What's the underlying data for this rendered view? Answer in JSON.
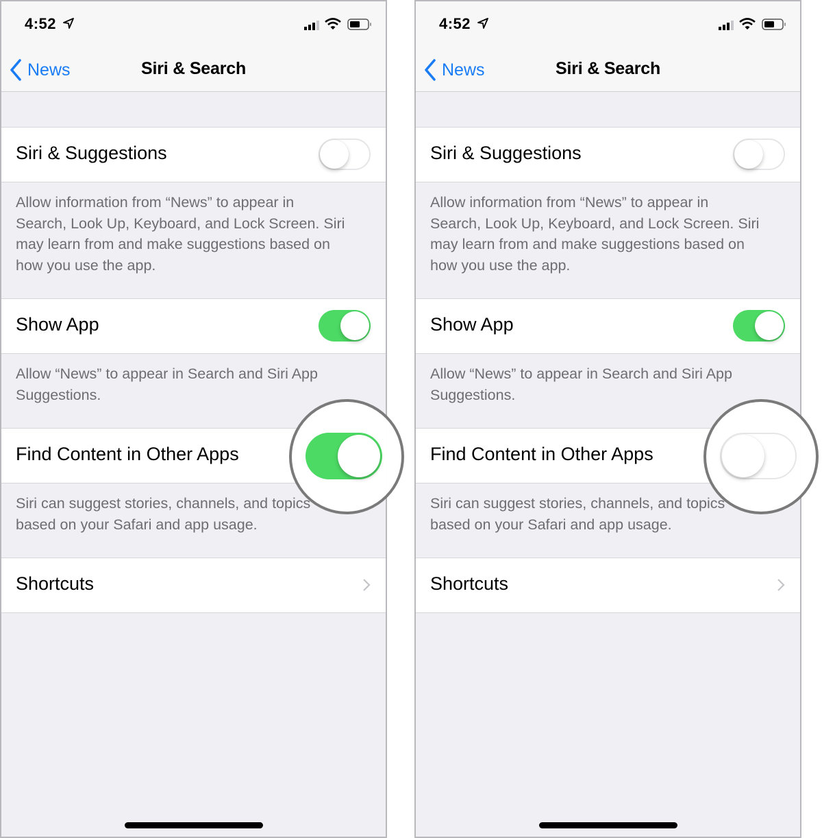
{
  "screens": [
    {
      "status": {
        "time": "4:52"
      },
      "nav": {
        "back_label": "News",
        "title": "Siri & Search"
      },
      "rows": {
        "siri_suggestions": {
          "label": "Siri & Suggestions",
          "on": false,
          "footer": [
            "Allow information from “News” to appear in",
            "Search, Look Up, Keyboard, and Lock Screen. Siri",
            "may learn from and make suggestions based on",
            "how you use the app."
          ]
        },
        "show_app": {
          "label": "Show App",
          "on": true,
          "footer": [
            "Allow “News” to appear in Search and Siri App",
            "Suggestions."
          ]
        },
        "find_content": {
          "label": "Find Content in Other Apps",
          "on": true,
          "highlighted": true,
          "footer": [
            "Siri can suggest stories, channels, and topics",
            "based on your Safari and app usage."
          ]
        },
        "shortcuts": {
          "label": "Shortcuts"
        }
      }
    },
    {
      "status": {
        "time": "4:52"
      },
      "nav": {
        "back_label": "News",
        "title": "Siri & Search"
      },
      "rows": {
        "siri_suggestions": {
          "label": "Siri & Suggestions",
          "on": false,
          "footer": [
            "Allow information from “News” to appear in",
            "Search, Look Up, Keyboard, and Lock Screen. Siri",
            "may learn from and make suggestions based on",
            "how you use the app."
          ]
        },
        "show_app": {
          "label": "Show App",
          "on": true,
          "footer": [
            "Allow “News” to appear in Search and Siri App",
            "Suggestions."
          ]
        },
        "find_content": {
          "label": "Find Content in Other Apps",
          "on": false,
          "highlighted": true,
          "footer": [
            "Siri can suggest stories, channels, and topics",
            "based on your Safari and app usage."
          ]
        },
        "shortcuts": {
          "label": "Shortcuts"
        }
      }
    }
  ],
  "colors": {
    "accent": "#1a7cf5",
    "switch_on": "#4cd964",
    "background": "#efeff4",
    "footer_text": "#6d6d72"
  },
  "icons": {
    "location": "location-arrow-icon",
    "signal": "cellular-signal-icon",
    "wifi": "wifi-icon",
    "battery": "battery-icon",
    "back": "chevron-left-icon",
    "disclosure": "chevron-right-icon"
  }
}
